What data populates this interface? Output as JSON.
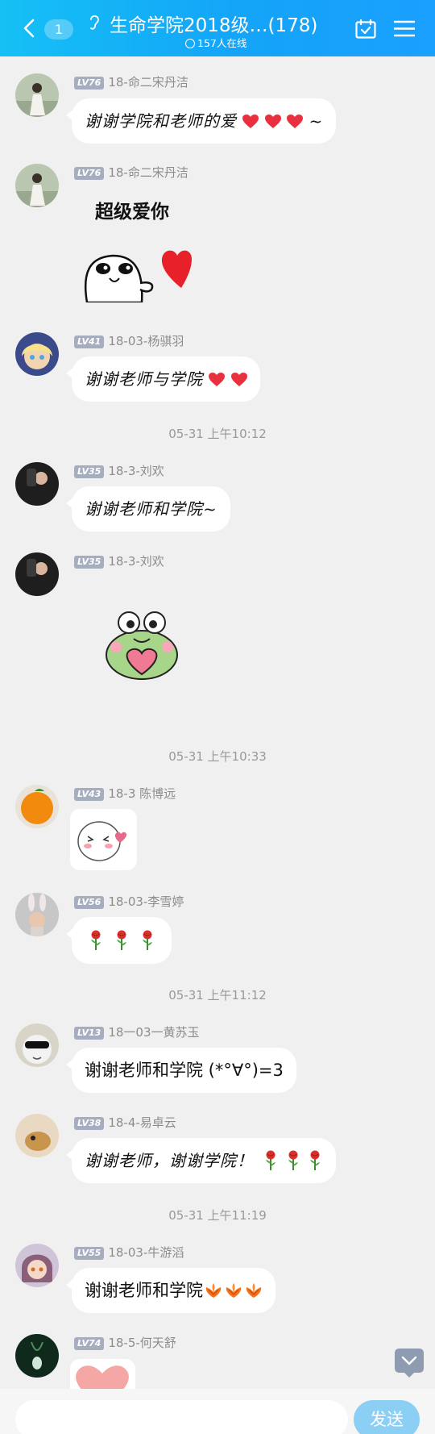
{
  "header": {
    "unread_count": "1",
    "title": "生命学院2018级…(178)",
    "online_text": "157人在线"
  },
  "messages": [
    {
      "level": "LV76",
      "sender": "18-命二宋丹洁",
      "text": "谢谢学院和老师的爱",
      "suffix": "~"
    },
    {
      "level": "LV76",
      "sender": "18-命二宋丹洁",
      "sticker_text": "超级爱你"
    },
    {
      "level": "LV41",
      "sender": "18-03-杨骐羽",
      "text": "谢谢老师与学院"
    },
    {
      "level": "LV35",
      "sender": "18-3-刘欢",
      "text": "谢谢老师和学院~"
    },
    {
      "level": "LV35",
      "sender": "18-3-刘欢"
    },
    {
      "level": "LV43",
      "sender": "18-3 陈博远"
    },
    {
      "level": "LV56",
      "sender": "18-03-李雪婷"
    },
    {
      "level": "LV13",
      "sender": "18一03一黄苏玉",
      "text": "谢谢老师和学院 (*°∀°)=3"
    },
    {
      "level": "LV38",
      "sender": "18-4-易卓云",
      "text": "谢谢老师，谢谢学院！"
    },
    {
      "level": "LV55",
      "sender": "18-03-牛游滔",
      "text": "谢谢老师和学院"
    },
    {
      "level": "LV74",
      "sender": "18-5-何天舒"
    }
  ],
  "timestamps": [
    "05-31 上午10:12",
    "05-31 上午10:33",
    "05-31 上午11:12",
    "05-31 上午11:19"
  ],
  "composer": {
    "placeholder": "",
    "send_label": "发送"
  },
  "colors": {
    "header_start": "#15c0f5",
    "header_end": "#1aa0ff",
    "send_button": "#8ccff5",
    "level_badge": "#a5adbf"
  }
}
